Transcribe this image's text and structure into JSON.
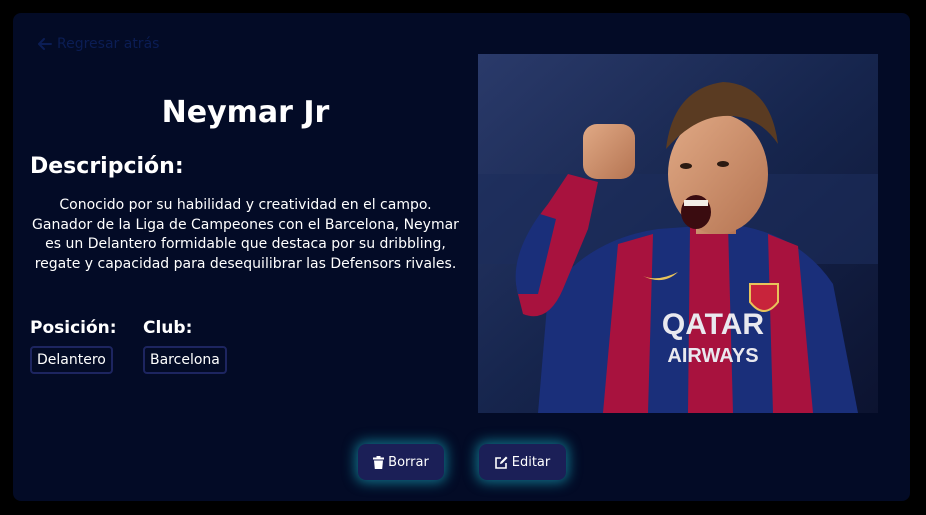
{
  "nav": {
    "back_label": "Regresar atrás",
    "back_icon": "arrow-left-icon"
  },
  "player": {
    "name": "Neymar Jr",
    "description_heading": "Descripción:",
    "description": "Conocido por su habilidad y creatividad en el campo. Ganador de la Liga de Campeones con el Barcelona, Neymar es un Delantero formidable que destaca por su dribbling, regate y capacidad para desequilibrar las Defensors rivales.",
    "position_label": "Posición:",
    "position_value": "Delantero",
    "club_label": "Club:",
    "club_value": "Barcelona",
    "photo_jersey_text": [
      "QATAR",
      "AIRWAYS"
    ]
  },
  "actions": {
    "delete_label": "Borrar",
    "delete_icon": "trash-icon",
    "edit_label": "Editar",
    "edit_icon": "edit-icon"
  },
  "colors": {
    "page_background": "#000000",
    "card_background": "#030b26",
    "button_background": "#1b1f57",
    "button_glow": "#1abcd2",
    "back_link": "#0b1d54",
    "tag_border": "#1d2560"
  }
}
